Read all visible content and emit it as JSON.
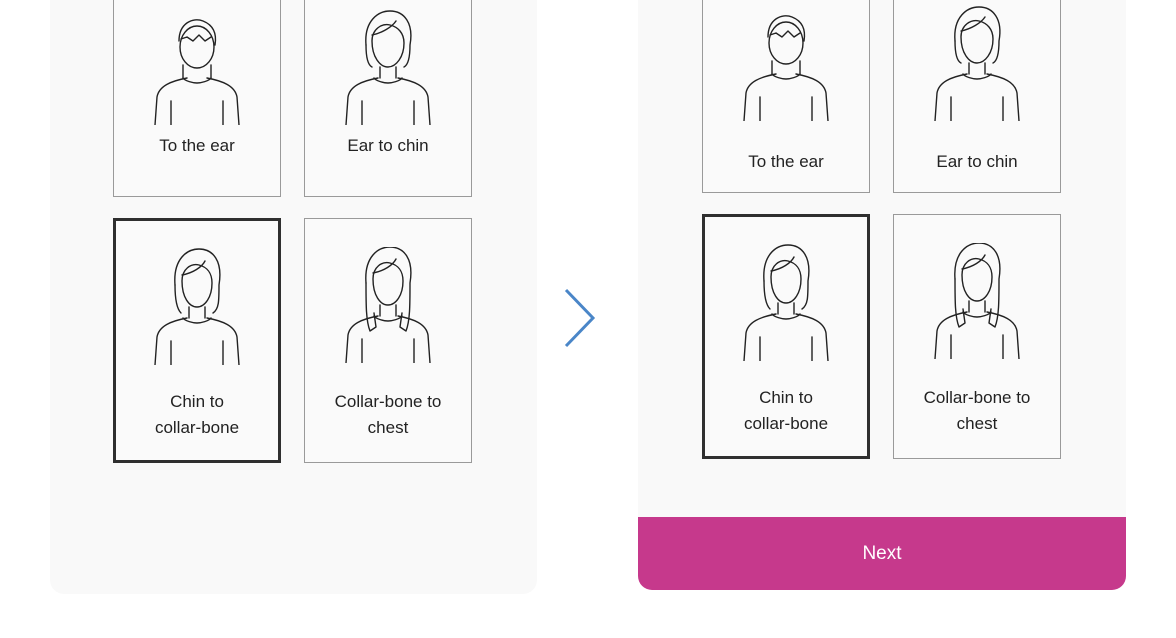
{
  "left_panel": {
    "options": [
      {
        "label": "To the ear",
        "selected": false
      },
      {
        "label": "Ear to chin",
        "selected": false
      },
      {
        "label_lines": [
          "Chin to",
          "collar-bone"
        ],
        "selected": true
      },
      {
        "label_lines": [
          "Collar-bone to",
          "chest"
        ],
        "selected": false
      }
    ]
  },
  "right_panel": {
    "options": [
      {
        "label": "To the ear",
        "selected": false
      },
      {
        "label": "Ear to chin",
        "selected": false
      },
      {
        "label_lines": [
          "Chin to",
          "collar-bone"
        ],
        "selected": true
      },
      {
        "label_lines": [
          "Collar-bone to",
          "chest"
        ],
        "selected": false
      }
    ],
    "next_label": "Next"
  },
  "icons": {
    "arrow": "chevron-right-icon",
    "hair_short": "short-hair-figure-icon",
    "hair_chin": "chin-length-hair-figure-icon",
    "hair_collar": "collar-length-hair-figure-icon",
    "hair_chest": "chest-length-hair-figure-icon"
  },
  "colors": {
    "accent": "#c6398c",
    "chevron": "#4a86c8",
    "selected_border": "#2f2f2f"
  }
}
